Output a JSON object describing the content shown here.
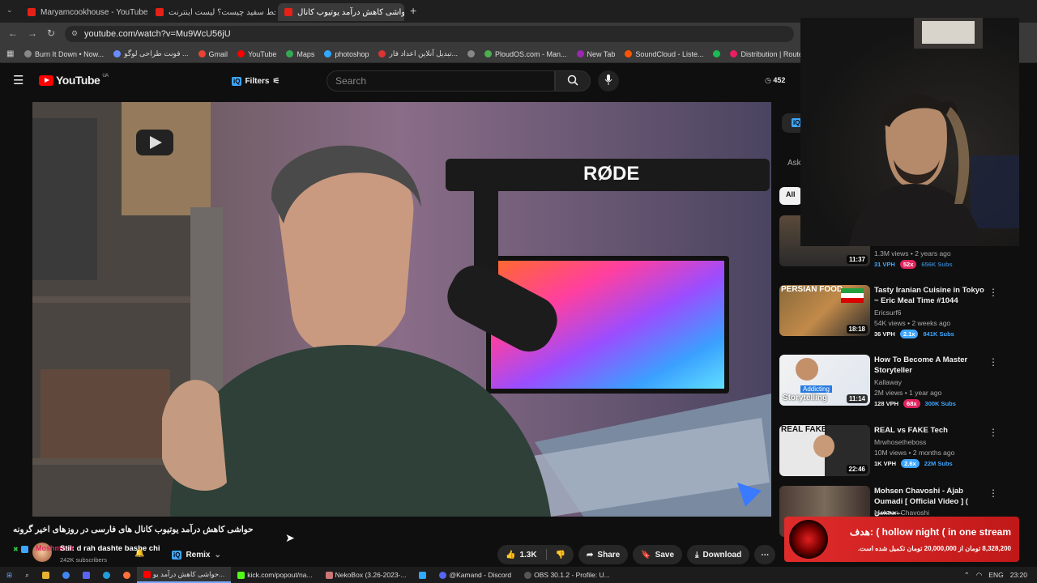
{
  "browser": {
    "tabs": [
      {
        "label": "Maryamcookhouse - YouTube",
        "active": false
      },
      {
        "label": "خط سفید چیست؟ لیست اینترنت",
        "active": false
      },
      {
        "label": "حواشی کاهش درآمد یوتیوب کانال",
        "active": true
      }
    ],
    "new_tab_label": "+",
    "url": "youtube.com/watch?v=Mu9WcU56jU",
    "bookmarks": [
      "Burn It Down • Now...",
      "فونت طراحی لوگو ...",
      "Gmail",
      "YouTube",
      "Maps",
      "photoshop",
      "تبدیل آنلاین اعداد فار...",
      "PloudOS.com - Man...",
      "New Tab",
      "SoundCloud - Liste...",
      "Distribution | Route..."
    ]
  },
  "youtube": {
    "logo_text": "YouTube",
    "region": "UA",
    "filters_label": "Filters",
    "search_placeholder": "Search",
    "viewer_count": "452"
  },
  "video": {
    "brand_text": "RØDE",
    "title": "حواشی کاهش درآمد یوتیوب کانال های فارسی در روزهای اخیر گرونه",
    "channel": "Moshmash",
    "subscribers": "242K subscribers",
    "chat_overlay": "Stii: d rah dashte bashe chi",
    "remix_label": "Remix",
    "like_count": "1.3K",
    "share_label": "Share",
    "save_label": "Save",
    "download_label": "Download"
  },
  "sidebar": {
    "chip_all": "All",
    "ask_label": "Ask",
    "first_partial": {
      "duration": "11:37",
      "meta": "1.3M views • 2 years ago",
      "vph": "31 VPH",
      "ratio": "52x",
      "subs": "656K Subs"
    },
    "items": [
      {
        "title": "Tasty Iranian Cuisine in Tokyo ~ Eric Meal Time #1044",
        "channel": "Ericsurf6",
        "meta": "54K views • 2 weeks ago",
        "duration": "18:18",
        "vph": "36 VPH",
        "ratio": "2.1x",
        "subs": "841K Subs",
        "thumb_text": "PERSIAN FOOD",
        "ratio_color": "#3ea6ff"
      },
      {
        "title": "How To Become A Master Storyteller",
        "channel": "Kallaway",
        "meta": "2M views • 1 year ago",
        "duration": "11:14",
        "vph": "128 VPH",
        "ratio": "68x",
        "subs": "300K Subs",
        "thumb_text": "Storytelling",
        "ratio_color": "#e0245e"
      },
      {
        "title": "REAL vs FAKE Tech",
        "channel": "Mrwhosetheboss",
        "meta": "10M views • 2 months ago",
        "duration": "22:46",
        "vph": "1K VPH",
        "ratio": "2.6x",
        "subs": "22M Subs",
        "thumb_text": "REAL FAKE",
        "ratio_color": "#3ea6ff"
      },
      {
        "title": "Mohsen Chavoshi - Ajab Oumadi [ Official Video ] ( محسن...",
        "channel": "Mohsen Chavoshi",
        "meta": "",
        "duration": "",
        "vph": "",
        "ratio": "",
        "subs": "",
        "thumb_text": "",
        "ratio_color": "#3ea6ff"
      }
    ]
  },
  "overlay": {
    "donation_title": "هدف: ( hollow night ( in one stream",
    "donation_amount": "8,328,200 تومان از 20,000,000 تومان تکمیل شده است."
  },
  "taskbar": {
    "items": [
      {
        "label": "حواشی کاهش درآمد یو...",
        "active": true
      },
      {
        "label": "kick.com/popout/na...",
        "active": false
      },
      {
        "label": "NekoBox (3.26-2023-...",
        "active": false
      },
      {
        "label": "@Kamand - Discord",
        "active": false
      },
      {
        "label": "OBS 30.1.2 - Profile: U...",
        "active": false
      }
    ],
    "lang": "ENG",
    "time": "23:20"
  },
  "colors": {
    "youtube_red": "#ff0000",
    "background": "#0f0f0f",
    "accent_blue": "#3ea6ff"
  }
}
